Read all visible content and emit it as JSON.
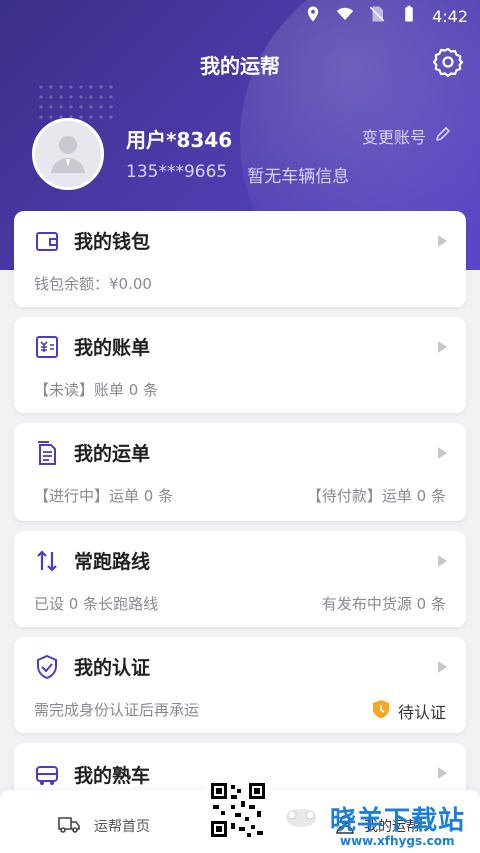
{
  "status_bar": {
    "time": "4:42"
  },
  "header": {
    "title": "我的运帮"
  },
  "user": {
    "name": "用户*8346",
    "phone": "135***9665",
    "vehicle_info": "暂无车辆信息",
    "change_account_label": "变更账号"
  },
  "cards": {
    "wallet": {
      "title": "我的钱包",
      "sub": "钱包余额：¥0.00"
    },
    "bill": {
      "title": "我的账单",
      "sub": "【未读】账单 0 条"
    },
    "waybill": {
      "title": "我的运单",
      "sub_left": "【进行中】运单 0 条",
      "sub_right": "【待付款】运单 0 条"
    },
    "routes": {
      "title": "常跑路线",
      "sub_left": "已设 0 条长跑路线",
      "sub_right": "有发布中货源 0 条"
    },
    "certification": {
      "title": "我的认证",
      "sub_left": "需完成身份认证后再承运",
      "sub_right": "待认证"
    },
    "familiar_vehicle": {
      "title": "我的熟车"
    }
  },
  "bottom_nav": {
    "home_label": "运帮首页",
    "mine_label": "我的运帮"
  },
  "watermark": {
    "text": "晓羊下载站",
    "url": "www.xfhygs.com"
  },
  "colors": {
    "accent": "#5a47c8",
    "header_dark": "#3a2f86",
    "badge": "#f5a623"
  }
}
